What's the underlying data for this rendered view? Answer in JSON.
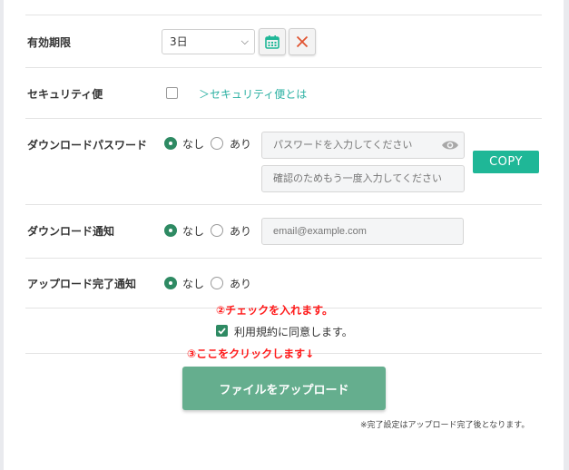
{
  "form": {
    "expiry": {
      "label": "有効期限",
      "selected": "3日",
      "calendar_icon": "calendar-icon",
      "clear_icon": "close-icon"
    },
    "security": {
      "label": "セキュリティ便",
      "checked": false,
      "link": "＞セキュリティ便とは"
    },
    "download_password": {
      "label": "ダウンロードパスワード",
      "options": [
        "なし",
        "あり"
      ],
      "selected": "なし",
      "password_placeholder": "パスワードを入力してください",
      "confirm_placeholder": "確認のためもう一度入力してください",
      "copy_label": "COPY",
      "eye_icon": "eye-icon"
    },
    "download_notify": {
      "label": "ダウンロード通知",
      "options": [
        "なし",
        "あり"
      ],
      "selected": "なし",
      "email_placeholder": "email@example.com"
    },
    "upload_notify": {
      "label": "アップロード完了通知",
      "options": [
        "なし",
        "あり"
      ],
      "selected": "なし"
    }
  },
  "annotations": {
    "step2": "②チェックを入れます。",
    "step3": "③ここをクリックします↓"
  },
  "terms": {
    "checked": true,
    "label": "利用規約に同意します。"
  },
  "upload_button": "ファイルをアップロード",
  "footnote": "※完了設定はアップロード完了後となります。",
  "colors": {
    "accent": "#1fb797",
    "upload": "#65ae8e",
    "radio_on": "#2e8a63",
    "annotation": "#ff1a1a"
  }
}
